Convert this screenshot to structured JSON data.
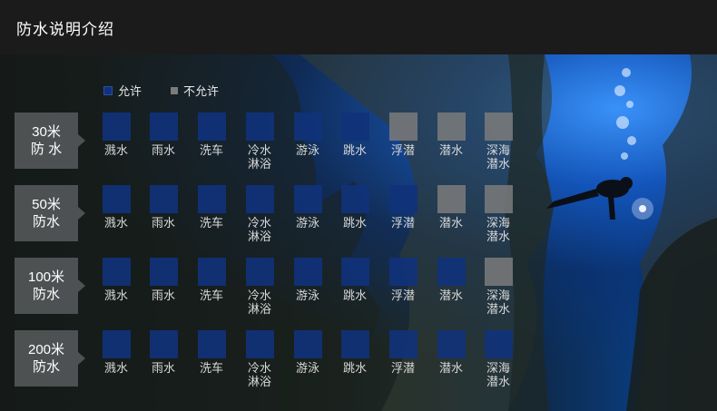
{
  "header": {
    "title": "防水说明介绍"
  },
  "legend": {
    "allowed_label": "允许",
    "not_allowed_label": "不允许"
  },
  "colors": {
    "allowed": "#10327a",
    "not_allowed": "#7b7b7b",
    "badge": "#545658",
    "header": "#1b1b1c"
  },
  "activities": [
    "溅水",
    "雨水",
    "洗车",
    "冷水淋浴",
    "游泳",
    "跳水",
    "浮潜",
    "潜水",
    "深海潜水"
  ],
  "rows": [
    {
      "depth": "30米",
      "label": "防 水",
      "allowed": [
        true,
        true,
        true,
        true,
        true,
        true,
        false,
        false,
        false
      ]
    },
    {
      "depth": "50米",
      "label": "防水",
      "allowed": [
        true,
        true,
        true,
        true,
        true,
        true,
        true,
        false,
        false
      ]
    },
    {
      "depth": "100米",
      "label": "防水",
      "allowed": [
        true,
        true,
        true,
        true,
        true,
        true,
        true,
        true,
        false
      ]
    },
    {
      "depth": "200米",
      "label": "防水",
      "allowed": [
        true,
        true,
        true,
        true,
        true,
        true,
        true,
        true,
        true
      ]
    }
  ]
}
